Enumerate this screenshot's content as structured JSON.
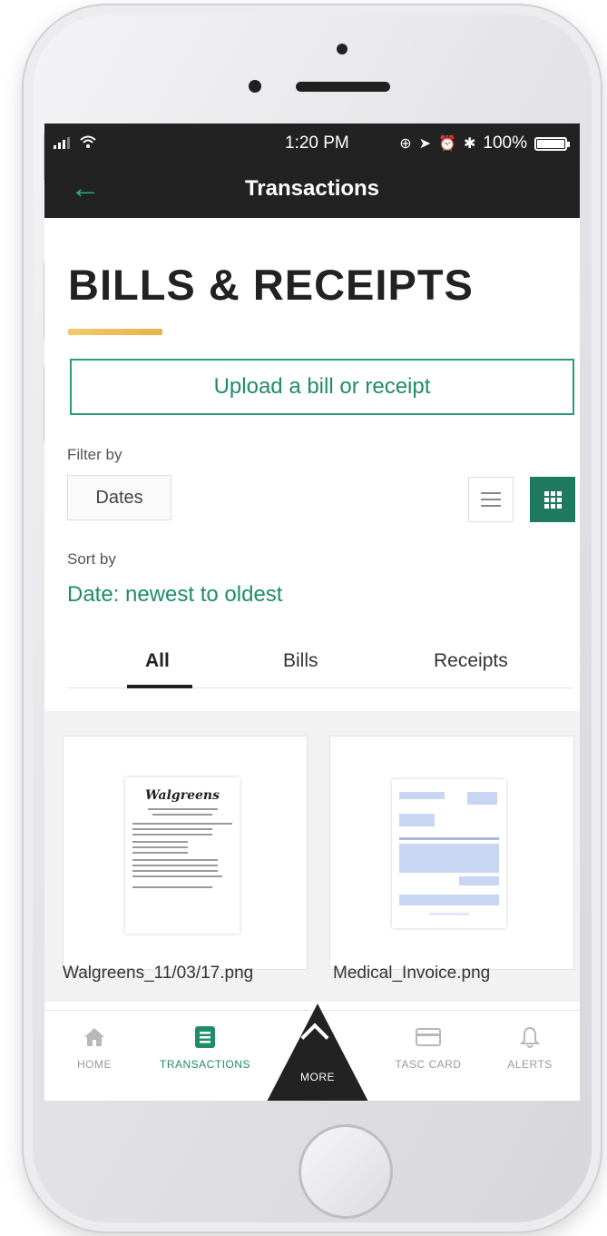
{
  "status_bar": {
    "time": "1:20 PM",
    "battery": "100%"
  },
  "nav": {
    "title": "Transactions"
  },
  "page": {
    "title": "BILLS & RECEIPTS"
  },
  "upload_button": "Upload a bill or receipt",
  "filter": {
    "label": "Filter by",
    "dates_button": "Dates"
  },
  "sort": {
    "label": "Sort by",
    "value": "Date: newest to oldest"
  },
  "tabs": [
    {
      "label": "All",
      "active": true
    },
    {
      "label": "Bills",
      "active": false
    },
    {
      "label": "Receipts",
      "active": false
    }
  ],
  "documents": [
    {
      "filename": "Walgreens_11/03/17.png",
      "thumbnail_text": "Walgreens"
    },
    {
      "filename": "Medical_Invoice.png"
    }
  ],
  "bottom_nav": [
    {
      "label": "HOME",
      "icon": "home-icon"
    },
    {
      "label": "TRANSACTIONS",
      "icon": "transactions-icon",
      "active": true
    },
    {
      "label": "MORE",
      "icon": "chevron-up-icon"
    },
    {
      "label": "TASC CARD",
      "icon": "card-icon"
    },
    {
      "label": "ALERTS",
      "icon": "bell-icon"
    }
  ],
  "colors": {
    "accent": "#1f8c6a",
    "bar": "#222222",
    "highlight": "#eab24a"
  }
}
